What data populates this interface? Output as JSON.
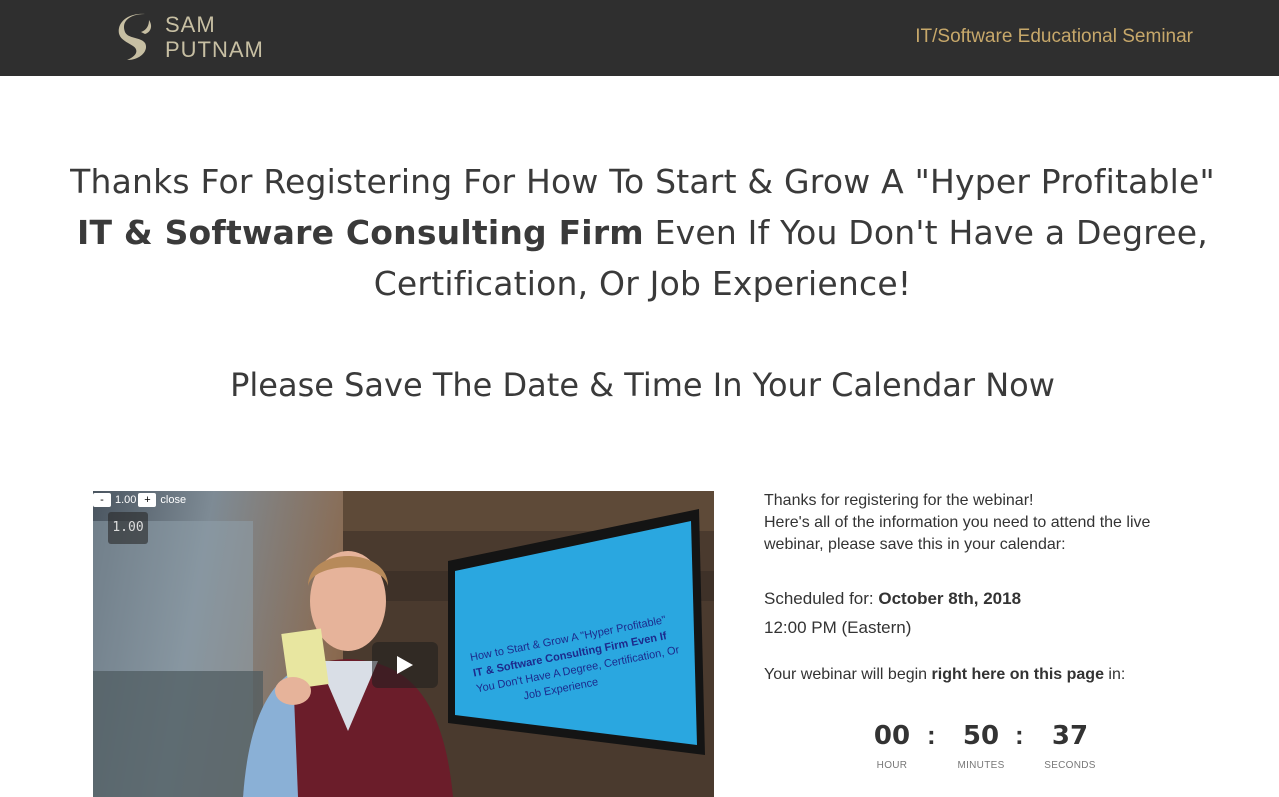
{
  "header": {
    "logo_line1": "SAM",
    "logo_line2": "PUTNAM",
    "tagline": "IT/Software Educational Seminar"
  },
  "headline": {
    "part1": "Thanks For Registering For How To Start & Grow A \"Hyper Profitable\"",
    "bold": "IT & Software Consulting Firm",
    "part2": " Even If You Don't Have a Degree, Certification, Or Job Experience!"
  },
  "subheadline": "Please Save The Date & Time In Your Calendar Now",
  "video": {
    "speed_minus": "-",
    "speed_value": "1.00",
    "speed_plus": "+",
    "speed_close": "close",
    "speed_badge": "1.00"
  },
  "info": {
    "intro_line1": "Thanks for registering for the webinar!",
    "intro_line2": "Here's all of the information you need to attend the live webinar, please save this in your calendar:",
    "scheduled_label": "Scheduled for: ",
    "scheduled_date": "October 8th, 2018",
    "scheduled_time": "12:00 PM (Eastern)",
    "begin_prefix": "Your webinar will begin ",
    "begin_bold": "right here on this page",
    "begin_suffix": " in:"
  },
  "countdown": {
    "hours": "00",
    "hours_label": "HOUR",
    "minutes": "50",
    "minutes_label": "MINUTES",
    "seconds": "37",
    "seconds_label": "SECONDS",
    "separator": ":"
  },
  "colors": {
    "header_bg": "#2f2f2f",
    "logo_color": "#c7bfa3",
    "tagline_color": "#c7a86a"
  }
}
